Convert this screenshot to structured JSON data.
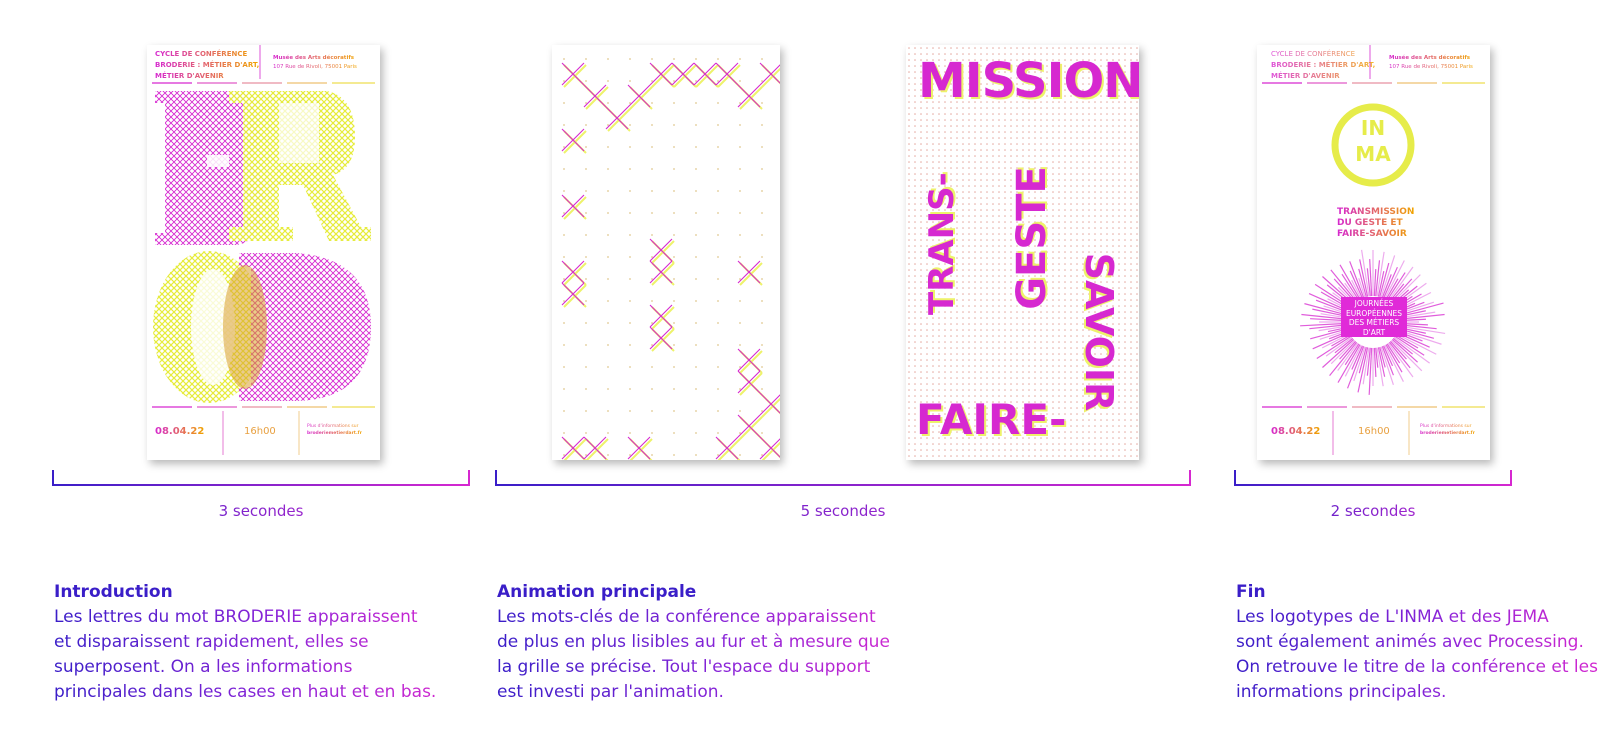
{
  "poster1": {
    "cycle_line1": "CYCLE DE CONFÉRENCE",
    "cycle_line2": "BRODERIE : MÉTIER D'ART,",
    "cycle_line3": "MÉTIER D'AVENIR",
    "venue_line1": "Musée des Arts décoratifs",
    "venue_line2": "107 Rue de Rivoli, 75001 Paris",
    "big_letters": "BROD",
    "date": "08.04.22",
    "time": "16h00",
    "info_line1": "Plus d'informations sur",
    "info_line2": "broderiemetierdart.fr"
  },
  "poster3": {
    "word_top": "MISSION",
    "word_left": "TRANS-",
    "word_mid": "GESTE",
    "word_right": "SAVOIR",
    "word_bottom": "FAIRE-"
  },
  "poster4": {
    "cycle_line1": "CYCLE DE CONFÉRENCE",
    "cycle_line2": "BRODERIE : MÉTIER D'ART,",
    "cycle_line3": "MÉTIER D'AVENIR",
    "venue_line1": "Musée des Arts décoratifs",
    "venue_line2": "107 Rue de Rivoli, 75001 Paris",
    "inma_top": "IN",
    "inma_bottom": "MA",
    "title_line1": "TRANSMISSION",
    "title_line2": "DU GESTE ET",
    "title_line3": "FAIRE-SAVOIR",
    "jema_line1": "JOURNÉES",
    "jema_line2": "EUROPÉENNES",
    "jema_line3": "DES MÉTIERS",
    "jema_line4": "D'ART",
    "date": "08.04.22",
    "time": "16h00",
    "info_line1": "Plus d'informations sur",
    "info_line2": "broderiemetierdart.fr"
  },
  "durations": {
    "intro": "3 secondes",
    "main": "5 secondes",
    "end": "2 secondes"
  },
  "sections": {
    "intro": {
      "title": "Introduction",
      "lines": [
        "Les lettres du mot BRODERIE apparaissent",
        "et disparaissent rapidement, elles se",
        "superposent. On a les informations",
        "principales dans les cases en haut et en bas."
      ]
    },
    "main": {
      "title": "Animation principale",
      "lines": [
        "Les mots-clés de la conférence apparaissent",
        "de plus en plus lisibles au fur et à mesure que",
        "la grille se précise. Tout l'espace du support",
        "est investi par l'animation."
      ]
    },
    "end": {
      "title": "Fin",
      "lines": [
        "Les logotypes de L'INMA et des JEMA",
        "sont également animés avec Processing.",
        "On retrouve le titre de la conférence et les",
        "informations principales."
      ]
    }
  },
  "colors": {
    "magenta": "#d628d0",
    "yellow": "#eef26a",
    "violet": "#3a1ec8",
    "orange": "#f0a400"
  }
}
